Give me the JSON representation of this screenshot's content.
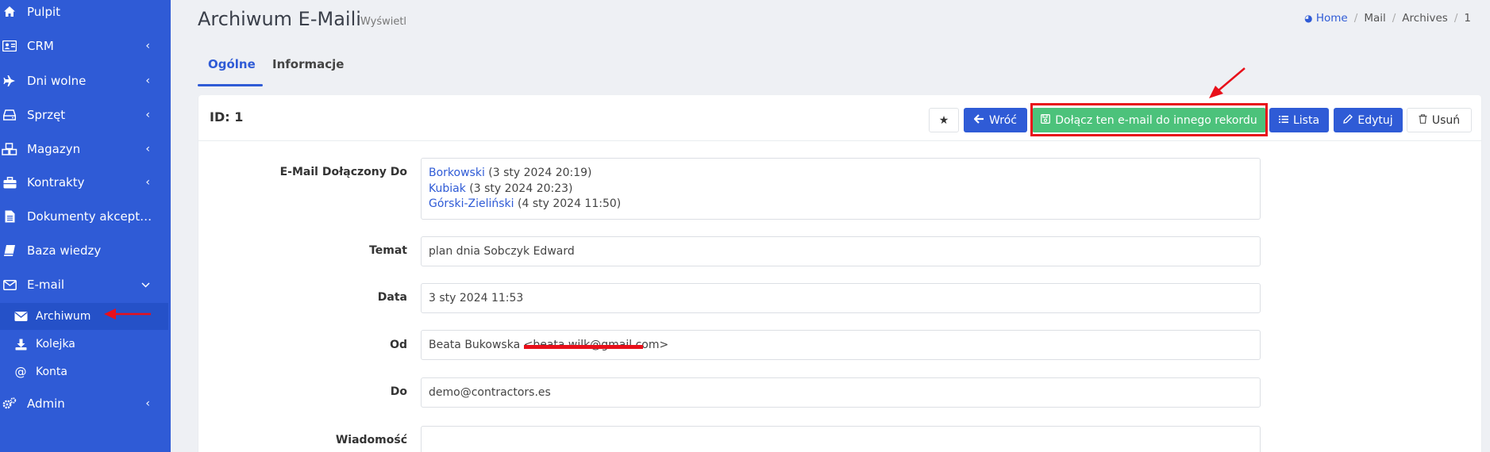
{
  "sidebar": {
    "items": [
      {
        "label": "Pulpit",
        "icon": "home-icon",
        "chevron": ""
      },
      {
        "label": "CRM",
        "icon": "address-card-icon",
        "chevron": "‹"
      },
      {
        "label": "Dni wolne",
        "icon": "plane-icon",
        "chevron": "‹"
      },
      {
        "label": "Sprzęt",
        "icon": "hdd-icon",
        "chevron": "‹"
      },
      {
        "label": "Magazyn",
        "icon": "boxes-icon",
        "chevron": "‹"
      },
      {
        "label": "Kontrakty",
        "icon": "briefcase-icon",
        "chevron": "‹"
      },
      {
        "label": "Dokumenty akceptacji",
        "icon": "file-icon",
        "chevron": ""
      },
      {
        "label": "Baza wiedzy",
        "icon": "book-icon",
        "chevron": ""
      },
      {
        "label": "E-mail",
        "icon": "envelope-icon",
        "chevron": "⌄"
      },
      {
        "label": "Admin",
        "icon": "cogs-icon",
        "chevron": "‹"
      }
    ],
    "email_sub": [
      {
        "label": "Archiwum",
        "icon": "envelope-solid-icon"
      },
      {
        "label": "Kolejka",
        "icon": "download-icon"
      },
      {
        "label": "Konta",
        "icon": "at-icon"
      }
    ]
  },
  "header": {
    "title": "Archiwum E-Maili",
    "subtitle": "Wyświetl",
    "breadcrumb": [
      "Home",
      "Mail",
      "Archives",
      "1"
    ]
  },
  "tabs": [
    {
      "label": "Ogólne",
      "active": true
    },
    {
      "label": "Informacje",
      "active": false
    }
  ],
  "card": {
    "id_label": "ID: 1",
    "buttons": {
      "star": "★",
      "back": "Wróć",
      "attach": "Dołącz ten e-mail do innego rekordu",
      "list": "Lista",
      "edit": "Edytuj",
      "delete": "Usuń"
    }
  },
  "form": {
    "attached_label": "E-Mail Dołączony Do",
    "attached": [
      {
        "name": "Borkowski",
        "date": "(3 sty 2024 20:19)"
      },
      {
        "name": "Kubiak",
        "date": "(3 sty 2024 20:23)"
      },
      {
        "name": "Górski-Zieliński",
        "date": "(4 sty 2024 11:50)"
      }
    ],
    "subject_label": "Temat",
    "subject": "plan dnia Sobczyk Edward",
    "date_label": "Data",
    "date": "3 sty 2024 11:53",
    "from_label": "Od",
    "from": "Beata Bukowska <beata.wilk@gmail.com>",
    "to_label": "Do",
    "to": "demo@contractors.es",
    "message_label": "Wiadomość",
    "message": ""
  },
  "colors": {
    "sidebar": "#2f5bd6",
    "primary": "#2f5bd6",
    "success": "#4cc27b",
    "annotation": "#e8101a"
  }
}
